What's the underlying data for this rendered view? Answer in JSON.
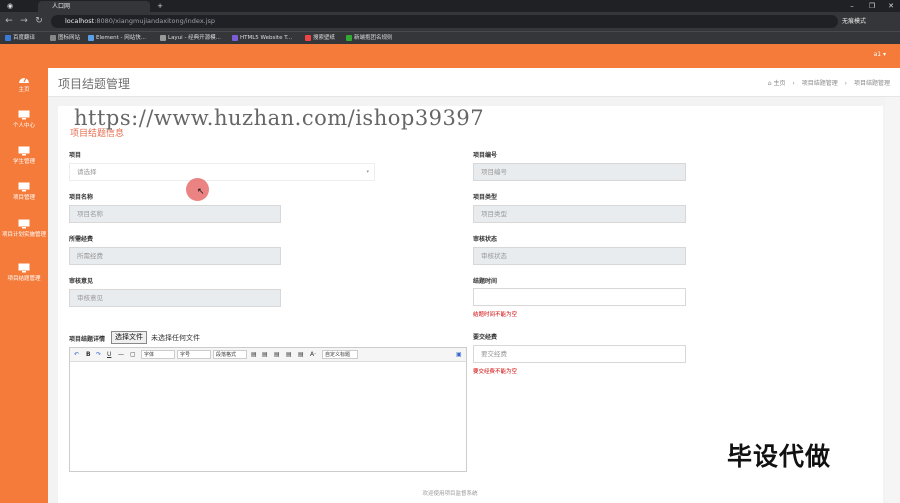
{
  "browser": {
    "tab_title": "人口网",
    "url_host": "localhost",
    "url_rest": ":8080/xiangmujiandaxitong/index.jsp",
    "incognito": "无痕模式",
    "bookmarks": [
      "百度翻译",
      "图标网站",
      "Element - 网站快...",
      "Layui - 经典开源模...",
      "HTML5 Website T...",
      "搜索壁纸",
      "新端抱团名规则"
    ]
  },
  "app": {
    "user": "a1 ▾",
    "page_title": "项目结题管理",
    "breadcrumb": [
      "⌂ 主页",
      "项目结题管理",
      "项目结题管理"
    ],
    "sidebar": [
      {
        "label": "主页",
        "icon": "dashboard-icon"
      },
      {
        "label": "个人中心",
        "icon": "monitor-icon"
      },
      {
        "label": "学生管理",
        "icon": "monitor-icon"
      },
      {
        "label": "项目管理",
        "icon": "monitor-icon"
      },
      {
        "label": "项目计划实施管理",
        "icon": "monitor-icon"
      },
      {
        "label": "项目结题管理",
        "icon": "monitor-icon"
      }
    ]
  },
  "form": {
    "section_title": "项目结题信息",
    "watermark": "https://www.huzhan.com/ishop39397",
    "project_label": "项目",
    "project_placeholder": "请选择",
    "project_no_label": "项目编号",
    "project_no_placeholder": "项目编号",
    "project_name_label": "项目名称",
    "project_name_placeholder": "项目名称",
    "project_type_label": "项目类型",
    "project_type_placeholder": "项目类型",
    "funds_label": "所需经费",
    "funds_placeholder": "所需经费",
    "review_status_label": "审核状态",
    "review_status_placeholder": "审核状态",
    "review_opinion_label": "审核意见",
    "review_opinion_placeholder": "审核意见",
    "end_time_label": "结题时间",
    "end_time_error": "结题时间不能为空",
    "detail_label": "项目结题详情",
    "file_button": "选择文件",
    "file_status": "未选择任何文件",
    "submit_funds_label": "要交经费",
    "submit_funds_placeholder": "要交经费",
    "submit_funds_error": "要交经费不能为空",
    "editor_font": "字体",
    "editor_size": "字号",
    "editor_para": "段落格式",
    "editor_custom": "自定义标题"
  },
  "overlay_text": "毕设代做",
  "footer": "欢迎使用项目监督系统"
}
